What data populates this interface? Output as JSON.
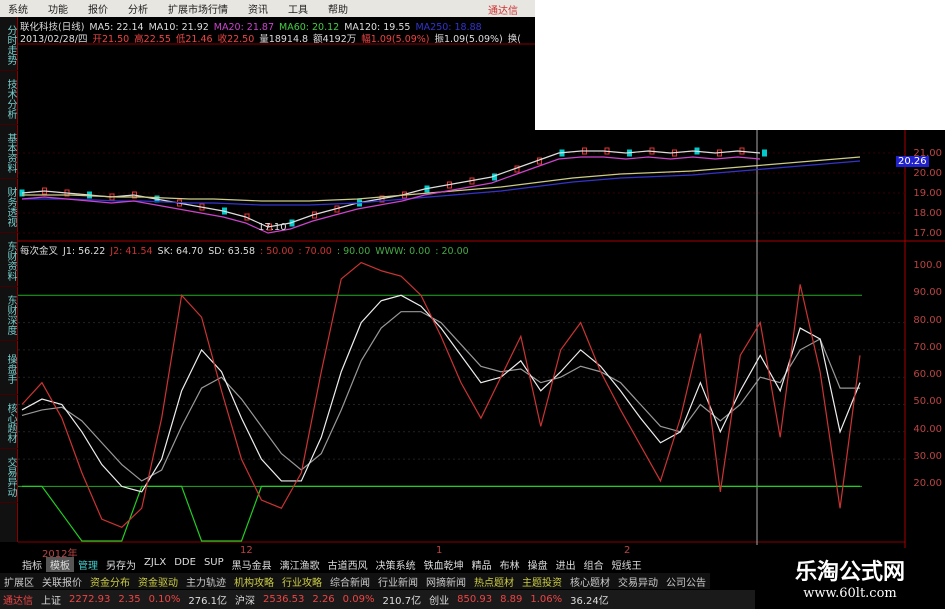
{
  "menu": [
    "系统",
    "功能",
    "报价",
    "分析",
    "扩展市场行情",
    "资讯",
    "工具",
    "帮助"
  ],
  "brand": "通达信",
  "info1": [
    {
      "t": "联化科技(日线)",
      "c": "#ddd"
    },
    {
      "t": "MA5: 22.14",
      "c": "#ddd"
    },
    {
      "t": "MA10: 21.92",
      "c": "#ddd"
    },
    {
      "t": "MA20: 21.87",
      "c": "#c4c"
    },
    {
      "t": "MA60: 20.12",
      "c": "#4c4"
    },
    {
      "t": "MA120: 19.55",
      "c": "#ddd"
    },
    {
      "t": "MA250: 18.88",
      "c": "#33c"
    }
  ],
  "info2": [
    {
      "t": "2013/02/28/四",
      "c": "#ddd"
    },
    {
      "t": "开21.50",
      "c": "#e44"
    },
    {
      "t": "高22.55",
      "c": "#e44"
    },
    {
      "t": "低21.46",
      "c": "#e44"
    },
    {
      "t": "收22.50",
      "c": "#e44"
    },
    {
      "t": "量18914.8",
      "c": "#ddd"
    },
    {
      "t": "额4192万",
      "c": "#ddd"
    },
    {
      "t": "幅1.09(5.09%)",
      "c": "#e44"
    },
    {
      "t": "振1.09(5.09%)",
      "c": "#ddd"
    },
    {
      "t": "换(",
      "c": "#ddd"
    }
  ],
  "sidebar": [
    "分时走势",
    "技术分析",
    "基本资料",
    "财务透视",
    "东财资料",
    "东财深度",
    "操盘手",
    "核心题材",
    "交易异动"
  ],
  "price_axis": [
    "21.00",
    "20.00",
    "19.00",
    "18.00",
    "17.00"
  ],
  "price_cursor": "20.26",
  "low_label": "17.10",
  "ind_line": [
    {
      "t": "每次金叉",
      "c": "#ddd"
    },
    {
      "t": "J1: 56.22",
      "c": "#ddd"
    },
    {
      "t": "J2: 41.54",
      "c": "#c33"
    },
    {
      "t": "SK: 64.70",
      "c": "#ddd"
    },
    {
      "t": "SD: 63.58",
      "c": "#ddd"
    },
    {
      "t": ": 50.00",
      "c": "#c33"
    },
    {
      "t": ": 70.00",
      "c": "#c33"
    },
    {
      "t": ": 90.00",
      "c": "#4a4"
    },
    {
      "t": "WWW: 0.00",
      "c": "#4a4"
    },
    {
      "t": ": 20.00",
      "c": "#4a4"
    }
  ],
  "ind_axis": [
    "100.0",
    "90.00",
    "80.00",
    "70.00",
    "60.00",
    "50.00",
    "40.00",
    "30.00",
    "20.00"
  ],
  "dates": [
    "2012年",
    "12",
    "1",
    "2"
  ],
  "tabs": [
    "指标",
    "模板",
    "管理",
    "另存为",
    "ZJLX",
    "DDE",
    "SUP",
    "黑马金县",
    "漓江渔歌",
    "古道西风",
    "决策系统",
    "铁血乾坤",
    "精品",
    "布林",
    "操盘",
    "进出",
    "组合",
    "短线王"
  ],
  "tabs2": [
    {
      "t": "扩展区",
      "c": "#ccc"
    },
    {
      "t": "关联报价",
      "c": "#ccc"
    },
    {
      "t": "资金分布",
      "c": "#cc4"
    },
    {
      "t": "资金驱动",
      "c": "#cc4"
    },
    {
      "t": "主力轨迹",
      "c": "#ccc"
    },
    {
      "t": "机构攻略",
      "c": "#cc4"
    },
    {
      "t": "行业攻略",
      "c": "#cc4"
    },
    {
      "t": "综合新闻",
      "c": "#ccc"
    },
    {
      "t": "行业新闻",
      "c": "#ccc"
    },
    {
      "t": "网摘新闻",
      "c": "#ccc"
    },
    {
      "t": "热点题材",
      "c": "#cc4"
    },
    {
      "t": "主题投资",
      "c": "#cc4"
    },
    {
      "t": "核心题材",
      "c": "#ccc"
    },
    {
      "t": "交易异动",
      "c": "#ccc"
    },
    {
      "t": "公司公告",
      "c": "#ccc"
    }
  ],
  "status": [
    {
      "t": "通达信",
      "c": "#e44"
    },
    {
      "t": "上证",
      "c": "#ddd"
    },
    {
      "t": "2272.93",
      "c": "#e44"
    },
    {
      "t": "2.35",
      "c": "#e44"
    },
    {
      "t": "0.10%",
      "c": "#e44"
    },
    {
      "t": "276.1亿",
      "c": "#ddd"
    },
    {
      "t": "沪深",
      "c": "#ddd"
    },
    {
      "t": "2536.53",
      "c": "#e44"
    },
    {
      "t": "2.26",
      "c": "#e44"
    },
    {
      "t": "0.09%",
      "c": "#e44"
    },
    {
      "t": "210.7亿",
      "c": "#ddd"
    },
    {
      "t": "创业",
      "c": "#ddd"
    },
    {
      "t": "850.93",
      "c": "#e44"
    },
    {
      "t": "8.89",
      "c": "#e44"
    },
    {
      "t": "1.06%",
      "c": "#e44"
    },
    {
      "t": "36.24亿",
      "c": "#ddd"
    }
  ],
  "watermark": {
    "title": "乐淘公式网",
    "url": "www.60lt.com"
  },
  "chart_data": {
    "price": {
      "ylim": [
        17,
        21
      ],
      "close": [
        19,
        19.1,
        19,
        18.9,
        18.8,
        18.9,
        18.7,
        18.5,
        18.3,
        18.1,
        17.8,
        17.3,
        17.5,
        17.9,
        18.2,
        18.5,
        18.7,
        18.9,
        19.2,
        19.4,
        19.6,
        19.8,
        20.2,
        20.6,
        21,
        21.1,
        21.1,
        21,
        21.1,
        21,
        21.1,
        21,
        21.1,
        21
      ],
      "ma_slow": [
        18.9,
        18.9,
        18.9,
        18.85,
        18.8,
        18.8,
        18.75,
        18.7,
        18.7,
        18.65,
        18.6,
        18.6,
        18.6,
        18.65,
        18.7,
        18.8,
        18.9,
        19,
        19.1,
        19.2,
        19.3,
        19.45,
        19.6,
        19.75,
        19.85,
        19.95,
        20,
        20.05,
        20.1,
        20.2,
        20.3,
        20.4,
        20.5,
        20.6,
        20.7,
        20.8
      ]
    },
    "kdj": {
      "ylim": [
        0,
        100
      ],
      "ref_lines": [
        90,
        20
      ],
      "j": [
        50,
        58,
        45,
        25,
        8,
        5,
        12,
        45,
        90,
        82,
        55,
        30,
        15,
        12,
        25,
        62,
        96,
        102,
        99,
        97,
        90,
        75,
        58,
        45,
        60,
        75,
        42,
        70,
        80,
        62,
        48,
        35,
        22,
        45,
        76,
        18,
        68,
        80,
        38,
        94,
        62,
        12,
        68
      ],
      "k": [
        48,
        52,
        50,
        40,
        28,
        20,
        18,
        30,
        55,
        70,
        62,
        45,
        30,
        22,
        22,
        38,
        62,
        80,
        88,
        90,
        86,
        78,
        68,
        58,
        60,
        66,
        55,
        62,
        70,
        64,
        55,
        45,
        36,
        40,
        58,
        40,
        55,
        68,
        55,
        78,
        74,
        40,
        58
      ],
      "d": [
        46,
        48,
        49,
        44,
        36,
        28,
        22,
        26,
        42,
        56,
        60,
        52,
        42,
        32,
        26,
        32,
        48,
        66,
        78,
        84,
        84,
        80,
        72,
        64,
        62,
        63,
        58,
        60,
        64,
        62,
        58,
        50,
        42,
        40,
        50,
        44,
        50,
        60,
        58,
        70,
        74,
        56,
        56
      ],
      "www": [
        20,
        20,
        10,
        0,
        0,
        0,
        20,
        20,
        20,
        0,
        0,
        0,
        20,
        20,
        20,
        20,
        20,
        20,
        20,
        20,
        20,
        20,
        20,
        20,
        20,
        20,
        20,
        20,
        20,
        20,
        20,
        20,
        20,
        20,
        20,
        20,
        20,
        20,
        20,
        20,
        20,
        20,
        20
      ]
    }
  }
}
